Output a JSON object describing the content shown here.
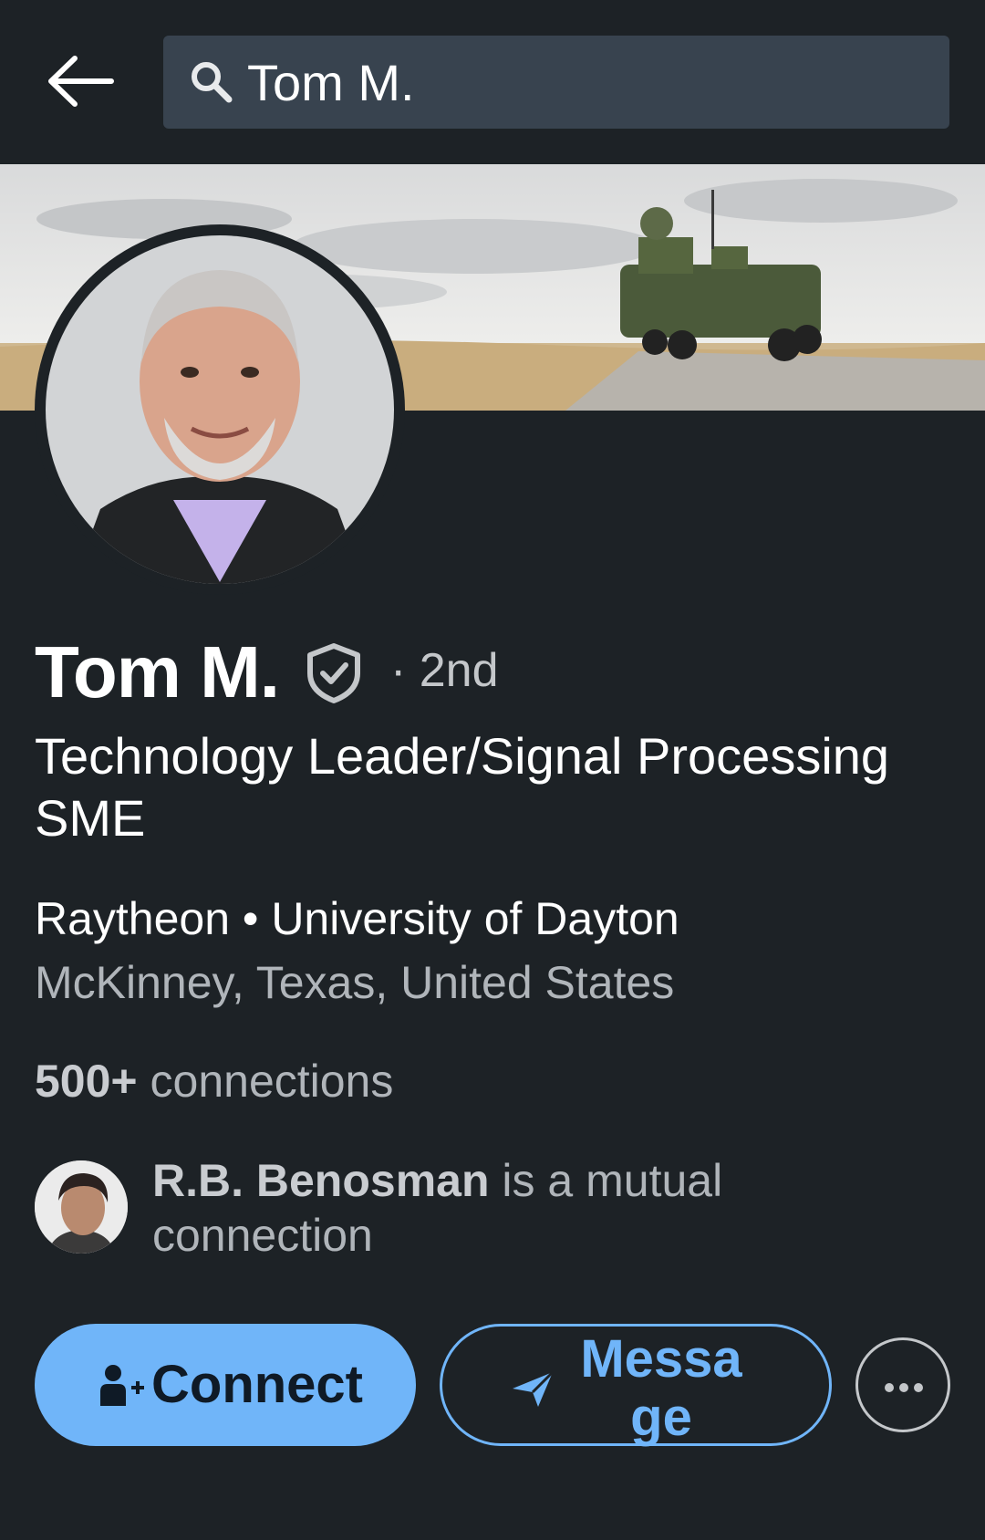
{
  "search": {
    "query": "Tom M."
  },
  "profile": {
    "name": "Tom M.",
    "degree": "· 2nd",
    "headline": "Technology Leader/Signal Processing SME",
    "company_line": "Raytheon • University of Dayton",
    "location": "McKinney, Texas, United States",
    "connections_count": "500+",
    "connections_label": " connections"
  },
  "mutual": {
    "name": "R.B. Benosman",
    "text": " is a mutual connection"
  },
  "actions": {
    "connect_label": "Connect",
    "message_label": "Message"
  },
  "colors": {
    "background": "#1d2226",
    "search_bg": "#38434f",
    "accent": "#70b5f9"
  },
  "icons": [
    "back-arrow-icon",
    "search-icon",
    "verified-shield-icon",
    "add-person-icon",
    "send-icon",
    "more-dots-icon"
  ]
}
